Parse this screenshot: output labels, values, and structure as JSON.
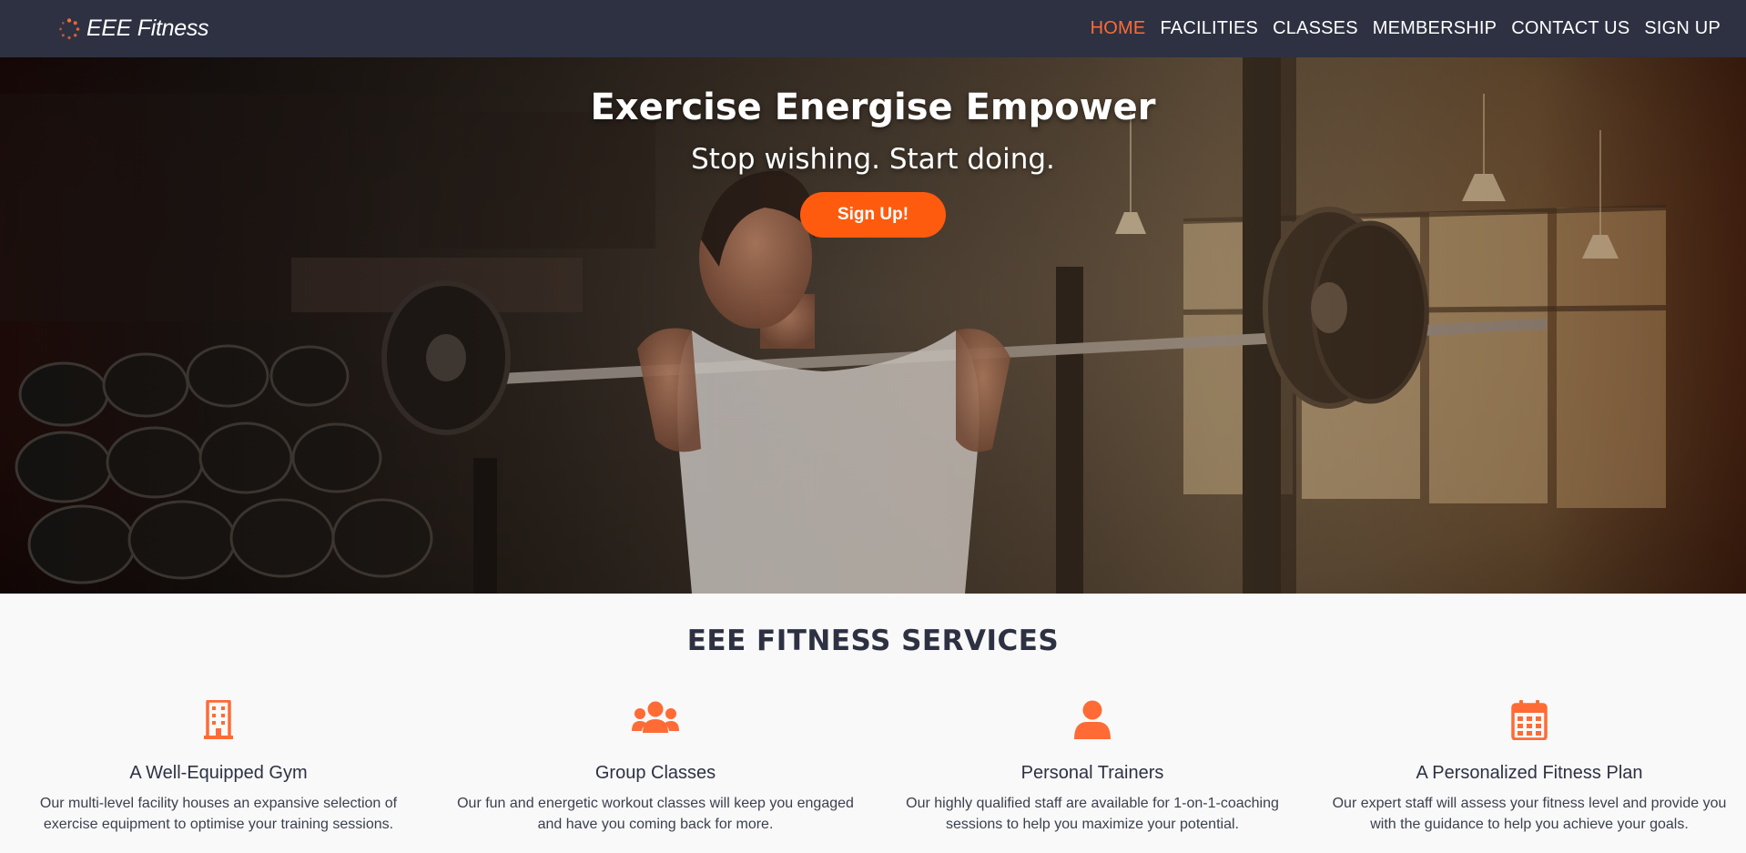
{
  "brand": {
    "name": "EEE Fitness",
    "icon": "spinner-dots-icon",
    "accent_color": "#ff6b35"
  },
  "nav": {
    "items": [
      {
        "label": "HOME",
        "active": true
      },
      {
        "label": "FACILITIES",
        "active": false
      },
      {
        "label": "CLASSES",
        "active": false
      },
      {
        "label": "MEMBERSHIP",
        "active": false
      },
      {
        "label": "CONTACT US",
        "active": false
      },
      {
        "label": "SIGN UP",
        "active": false
      }
    ],
    "background": "#2d3142"
  },
  "hero": {
    "title": "Exercise Energise Empower",
    "subtitle": "Stop wishing. Start doing.",
    "button_label": "Sign Up!",
    "button_color": "#ff5b0f"
  },
  "services": {
    "heading": "EEE FITNESS SERVICES",
    "items": [
      {
        "icon": "building-icon",
        "title": "A Well-Equipped Gym",
        "description_line1": "Our multi-level facility houses an expansive selection of",
        "description_line2": "exercise equipment to optimise your training sessions."
      },
      {
        "icon": "users-icon",
        "title": "Group Classes",
        "description_line1": "Our fun and energetic workout classes will keep you engaged",
        "description_line2": "and have you coming back for more."
      },
      {
        "icon": "user-icon",
        "title": "Personal Trainers",
        "description_line1": "Our highly qualified staff are available for 1-on-1-coaching",
        "description_line2": "sessions to help you maximize your potential."
      },
      {
        "icon": "calendar-icon",
        "title": "A Personalized Fitness Plan",
        "description_line1": "Our expert staff will assess your fitness level and provide you",
        "description_line2": "with the guidance to help you achieve your goals."
      }
    ]
  }
}
